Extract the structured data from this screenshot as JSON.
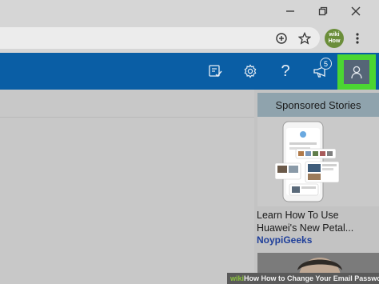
{
  "browser": {
    "ext_avatar_text": "wiki How",
    "icons": {
      "minimize": "minimize-icon",
      "restore": "restore-icon",
      "close": "close-icon",
      "zoom": "zoom-in-icon",
      "bookmark": "star-icon",
      "menu": "kebab-menu-icon"
    }
  },
  "header": {
    "icons": [
      "todo-icon",
      "gear-icon",
      "help-icon",
      "megaphone-icon",
      "person-icon"
    ],
    "help_glyph": "?",
    "notification_count": "5",
    "highlight_color": "#4bd632",
    "brand_color": "#0a5ea5"
  },
  "sponsored": {
    "heading": "Sponsored Stories",
    "ad": {
      "title": "Learn How To Use Huawei's New Petal...",
      "source": "NoypiGeeks"
    }
  },
  "footer": {
    "brand_part": "wiki",
    "brand_rest": "How",
    "caption": "How to Change Your Email Password"
  }
}
